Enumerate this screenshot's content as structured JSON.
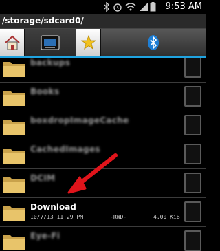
{
  "status_bar": {
    "time": "9:53 AM",
    "icons": [
      "usb-icon",
      "bluetooth-icon",
      "alarm-icon",
      "wifi-icon",
      "signal-icon",
      "battery-icon"
    ]
  },
  "path_bar": {
    "path": "/storage/sdcard0/"
  },
  "tabs": [
    {
      "name": "home",
      "icon": "home-icon",
      "active": true
    },
    {
      "name": "storage",
      "icon": "sdcard-icon",
      "active": false
    },
    {
      "name": "favorites",
      "icon": "star-icon",
      "active": false
    },
    {
      "name": "bluetooth",
      "icon": "bluetooth-icon",
      "active": false
    }
  ],
  "files": [
    {
      "name": "backups",
      "blurred": true,
      "date": "",
      "perms": "",
      "size": ""
    },
    {
      "name": "Books",
      "blurred": true,
      "date": "",
      "perms": "",
      "size": ""
    },
    {
      "name": "boxdropImageCache",
      "blurred": true,
      "date": "",
      "perms": "",
      "size": ""
    },
    {
      "name": "CachedImages",
      "blurred": true,
      "date": "",
      "perms": "",
      "size": ""
    },
    {
      "name": "DCIM",
      "blurred": true,
      "date": "",
      "perms": "",
      "size": ""
    },
    {
      "name": "Download",
      "blurred": false,
      "date": "10/7/13 11:29 PM",
      "perms": "-RWD-",
      "size": "4.00 KiB"
    },
    {
      "name": "Eye-Fi",
      "blurred": true,
      "date": "",
      "perms": "",
      "size": ""
    }
  ],
  "colors": {
    "accent": "#1fa3e0",
    "arrow": "#e0141b",
    "folder": "#e8c46a"
  }
}
